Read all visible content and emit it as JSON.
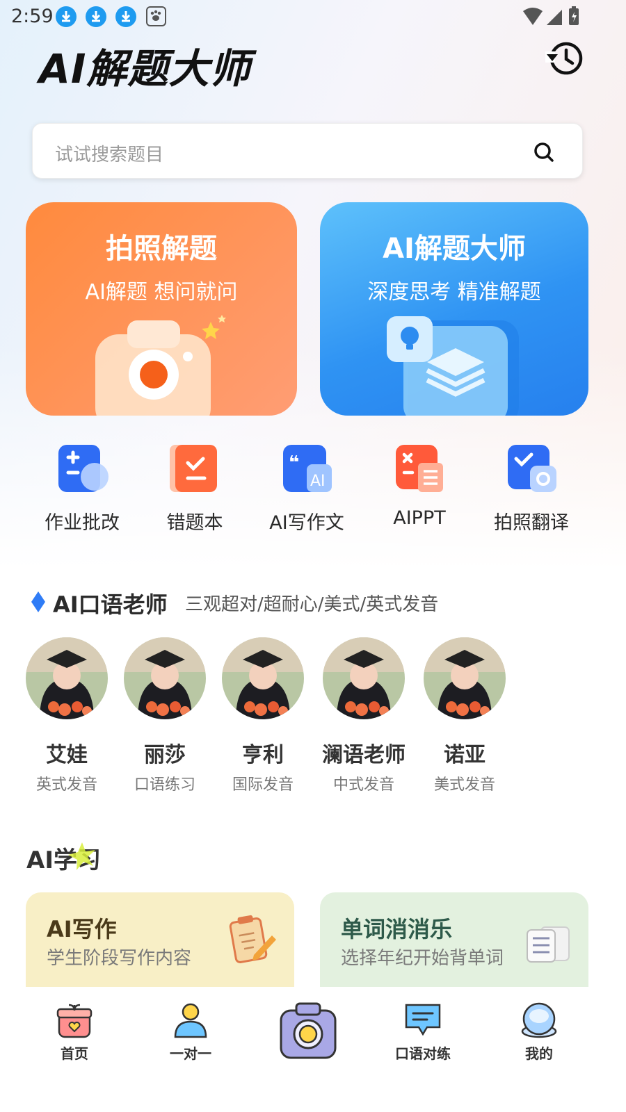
{
  "status": {
    "time": "2:59"
  },
  "header": {
    "title": "AI解题大师"
  },
  "search": {
    "placeholder": "试试搜索题目"
  },
  "cards": [
    {
      "title": "拍照解题",
      "subtitle": "AI解题  想问就问"
    },
    {
      "title": "AI解题大师",
      "subtitle": "深度思考  精准解题"
    }
  ],
  "tools": [
    {
      "label": "作业批改"
    },
    {
      "label": "错题本"
    },
    {
      "label": "AI写作文"
    },
    {
      "label": "AIPPT"
    },
    {
      "label": "拍照翻译"
    }
  ],
  "tutors_section": {
    "title": "AI口语老师",
    "subtitle": "三观超对/超耐心/美式/英式发音"
  },
  "tutors": [
    {
      "name": "艾娃",
      "desc": "英式发音"
    },
    {
      "name": "丽莎",
      "desc": "口语练习"
    },
    {
      "name": "亨利",
      "desc": "国际发音"
    },
    {
      "name": "澜语老师",
      "desc": "中式发音"
    },
    {
      "name": "诺亚",
      "desc": "美式发音"
    }
  ],
  "study": {
    "title": "AI学习",
    "cards": [
      {
        "title": "AI写作",
        "subtitle": "学生阶段写作内容"
      },
      {
        "title": "单词消消乐",
        "subtitle": "选择年纪开始背单词"
      }
    ]
  },
  "nav": [
    {
      "label": "首页"
    },
    {
      "label": "一对一"
    },
    {
      "label": "口语对练"
    },
    {
      "label": "我的"
    }
  ],
  "colors": {
    "orange_card": "#ff8a3d",
    "blue_card": "#2f93f3",
    "accent": "#1e9bf0"
  }
}
